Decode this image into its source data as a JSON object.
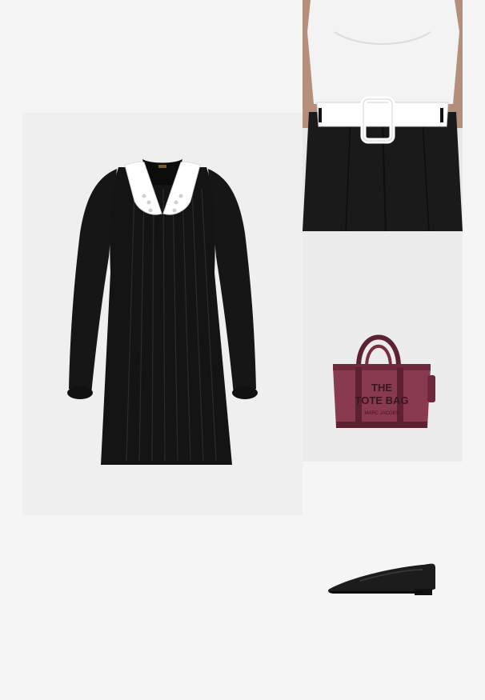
{
  "collage": {
    "items": [
      {
        "name": "dress",
        "description_hidden": true
      },
      {
        "name": "belt-outfit"
      },
      {
        "name": "tote-bag"
      },
      {
        "name": "flat-shoe"
      }
    ]
  },
  "bag": {
    "print_line1": "THE",
    "print_line2": "TOTE BAG",
    "print_line3": "MARC JACOBS",
    "color": "#8a3a4e"
  },
  "colors": {
    "background": "#f5f5f5",
    "dress": "#141414",
    "collar": "#ffffff",
    "belt": "#ffffff",
    "trousers": "#1a1a1a",
    "shoe": "#1c1c1c"
  }
}
